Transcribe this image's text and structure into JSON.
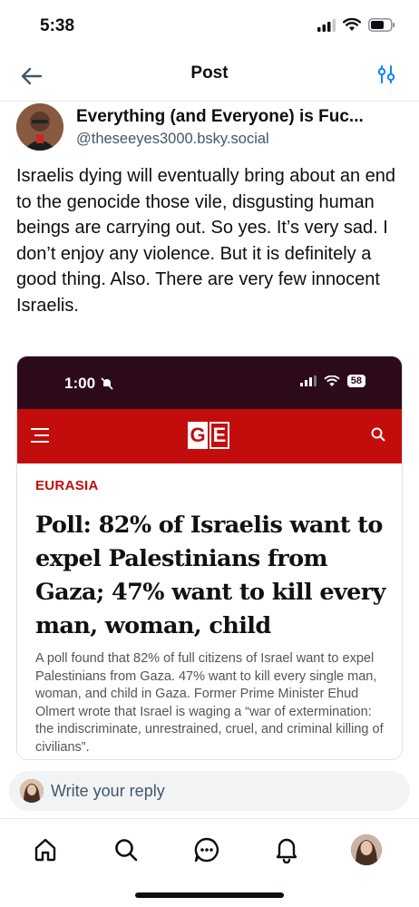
{
  "status_bar": {
    "time": "5:38"
  },
  "header": {
    "title": "Post"
  },
  "author": {
    "display_name": "Everything (and Everyone) is Fuc...",
    "handle": "@theseeyes3000.bsky.social"
  },
  "post": {
    "text": "Israelis dying will eventually bring about an end to the genocide those vile, disgusting human beings are carrying out. So yes. It’s very sad. I don’t enjoy any violence. But it is definitely a good thing. Also. There are very few innocent Israelis."
  },
  "embed": {
    "time": "1:00",
    "battery": "58",
    "logo_letters": [
      "G",
      "E"
    ],
    "category": "EURASIA",
    "headline": "Poll: 82% of Israelis want to expel Palestinians from Gaza; 47% want to kill every man, woman, child",
    "summary": "A poll found that 82% of full citizens of Israel want to expel Palestinians from Gaza. 47% want to kill every single man, woman, and child in Gaza. Former Prime Minister Ehud Olmert wrote that Israel is waging a “war of extermination: the indiscriminate, unrestrained, cruel, and criminal killing of civilians”.",
    "brand_color": "#c30d0d",
    "status_color": "#2c0a1a"
  },
  "reply": {
    "placeholder": "Write your reply"
  },
  "tabs": [
    "home-icon",
    "search-icon",
    "chat-icon",
    "bell-icon",
    "profile-avatar"
  ],
  "colors": {
    "accent": "#1083fe",
    "muted_text": "#42576c"
  }
}
